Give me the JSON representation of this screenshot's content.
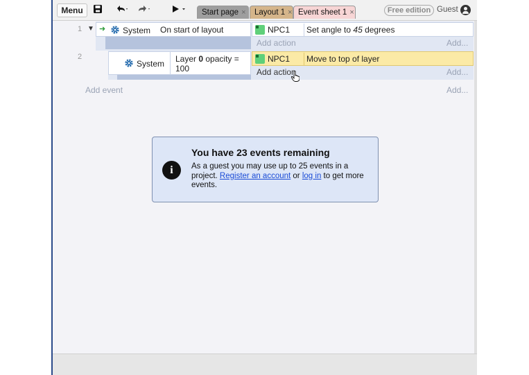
{
  "toolbar": {
    "menu_label": "Menu",
    "icons": [
      "save-icon",
      "undo-icon",
      "redo-icon",
      "play-icon"
    ],
    "tabs": [
      {
        "label": "Start page",
        "close": "×"
      },
      {
        "label": "Layout 1",
        "close": "×"
      },
      {
        "label": "Event sheet 1",
        "close": "×"
      }
    ],
    "edition_badge": "Free edition",
    "user_label": "Guest"
  },
  "events": [
    {
      "number": "1",
      "condition": {
        "object": "System",
        "text": "On start of layout"
      },
      "actions": [
        {
          "object": "NPC1",
          "pre": "Set angle to ",
          "italic": "45",
          "post": " degrees"
        }
      ],
      "add_action": "Add action",
      "add_more": "Add..."
    },
    {
      "number": "2",
      "condition": {
        "object": "System",
        "pre": "Layer ",
        "bold": "0",
        "post": " opacity = 100"
      },
      "actions": [
        {
          "object": "NPC1",
          "text": "Move to top of layer"
        }
      ],
      "add_action": "Add action",
      "add_more": "Add..."
    }
  ],
  "add_event": "Add event",
  "add_event_more": "Add...",
  "dialog": {
    "title": "You have 23 events remaining",
    "body_pre": "As a guest you may use up to 25 events in a project. ",
    "link_register": "Register an account",
    "body_mid": " or ",
    "link_login": "log in",
    "body_post": " to get more events.",
    "icon": "info-icon"
  },
  "colors": {
    "accent_green": "#5fd07a",
    "selected_row": "#fbeaa6",
    "dialog_bg": "#dde6f7",
    "link": "#1a4bd6"
  }
}
